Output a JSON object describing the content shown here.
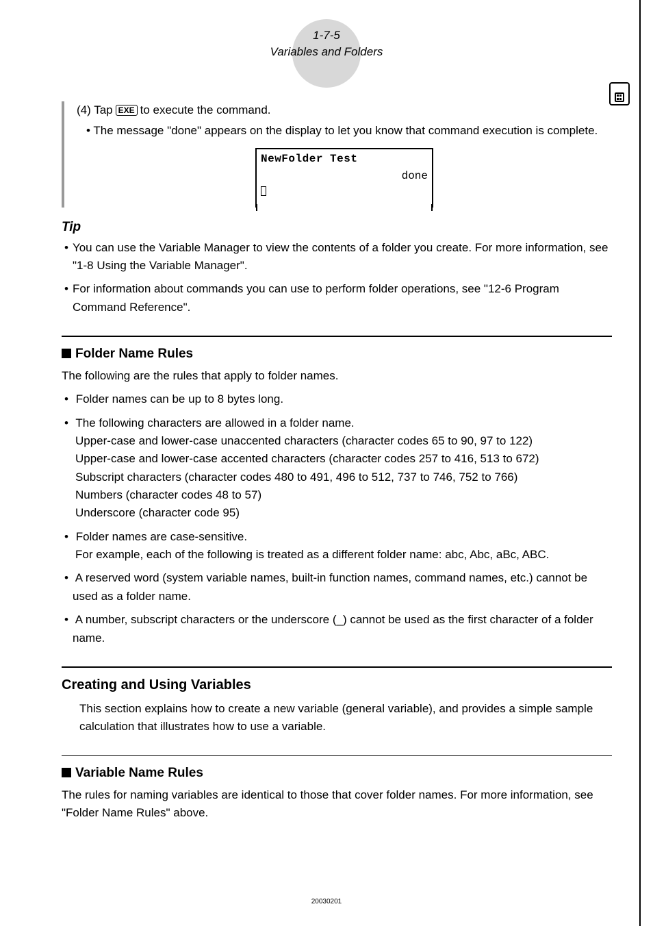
{
  "header": {
    "page_ref": "1-7-5",
    "title": "Variables and Folders"
  },
  "step": {
    "prefix": "(4) Tap",
    "key": "EXE",
    "suffix": "to execute the command.",
    "bullet": "The message \"done\" appears on the display to let you know that command execution is complete."
  },
  "screenshot": {
    "line1": "NewFolder Test",
    "line2": "done"
  },
  "tip": {
    "title": "Tip",
    "items": [
      "You can use the Variable Manager to view the contents of a folder you create. For more information, see \"1-8 Using the Variable Manager\".",
      "For information about commands you can use to perform folder operations, see \"12-6 Program Command Reference\"."
    ]
  },
  "folder_rules": {
    "heading": "Folder Name Rules",
    "intro": "The following are the rules that apply to folder names.",
    "items": [
      {
        "main": "Folder names can be up to 8 bytes long.",
        "subs": []
      },
      {
        "main": "The following characters are allowed in a folder name.",
        "subs": [
          "Upper-case and lower-case unaccented characters (character codes 65 to 90, 97 to 122)",
          "Upper-case and lower-case accented characters (character codes 257 to 416, 513 to 672)",
          "Subscript characters (character codes 480 to 491, 496 to 512, 737 to 746, 752 to 766)",
          "Numbers (character codes 48 to 57)",
          "Underscore (character code 95)"
        ]
      },
      {
        "main": "Folder names are case-sensitive.",
        "subs": [
          "For example, each of the following is treated as a different folder name: abc, Abc, aBc, ABC."
        ]
      },
      {
        "main": "A reserved word (system variable names, built-in function names, command names, etc.) cannot be used as a folder name.",
        "subs": []
      },
      {
        "main": "A number, subscript characters or the underscore (_) cannot be used as the first character of a folder name.",
        "subs": []
      }
    ]
  },
  "creating": {
    "heading": "Creating and Using Variables",
    "para": "This section explains how to create a new variable (general variable), and provides a simple sample calculation that illustrates how to use a variable."
  },
  "variable_rules": {
    "heading": "Variable Name Rules",
    "para": "The rules for naming variables are identical to those that cover folder names. For more information, see \"Folder Name Rules\" above."
  },
  "footer": "20030201"
}
